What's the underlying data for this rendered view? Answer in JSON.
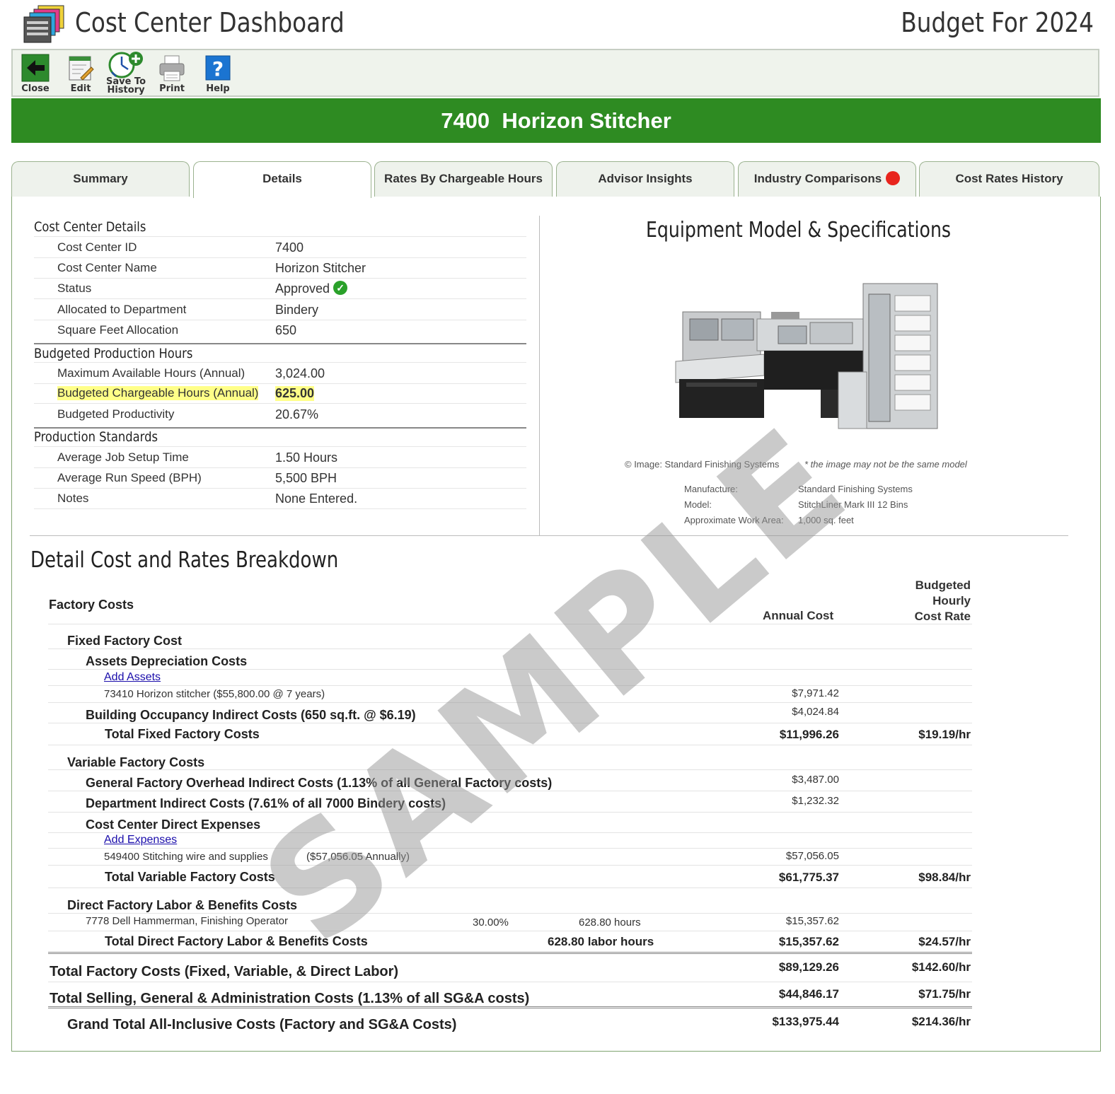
{
  "header": {
    "title": "Cost Center Dashboard",
    "budget_title": "Budget For 2024"
  },
  "toolbar": {
    "close": "Close",
    "edit": "Edit",
    "save_line1": "Save To",
    "save_line2": "History",
    "print": "Print",
    "help": "Help"
  },
  "banner": "7400  Horizon Stitcher",
  "tabs": [
    {
      "label": "Summary"
    },
    {
      "label": "Details"
    },
    {
      "label": "Rates By Chargeable Hours"
    },
    {
      "label": "Advisor Insights"
    },
    {
      "label": "Industry Comparisons"
    },
    {
      "label": "Cost Rates History"
    }
  ],
  "details": {
    "section1": "Cost Center Details",
    "rows1": [
      {
        "label": "Cost Center ID",
        "value": "7400"
      },
      {
        "label": "Cost Center Name",
        "value": "Horizon Stitcher"
      },
      {
        "label": "Status",
        "value": "Approved"
      },
      {
        "label": "Allocated to Department",
        "value": "Bindery"
      },
      {
        "label": "Square Feet Allocation",
        "value": "650"
      }
    ],
    "section2": "Budgeted Production Hours",
    "rows2": [
      {
        "label": "Maximum Available Hours (Annual)",
        "value": "3,024.00"
      },
      {
        "label": "Budgeted Chargeable Hours (Annual)",
        "value": "625.00"
      },
      {
        "label": "Budgeted Productivity",
        "value": "20.67%"
      }
    ],
    "section3": "Production Standards",
    "rows3": [
      {
        "label": "Average Job Setup Time",
        "value": "1.50 Hours"
      },
      {
        "label": "Average Run Speed  (BPH)",
        "value": "5,500 BPH"
      },
      {
        "label": "Notes",
        "value": "None Entered."
      }
    ]
  },
  "equipment": {
    "title": "Equipment Model & Specifications",
    "credit": "© Image: Standard Finishing Systems",
    "credit_note": "* the image may not be the same model",
    "specs": [
      {
        "key": "Manufacture:",
        "value": "Standard Finishing Systems"
      },
      {
        "key": "Model:",
        "value": "StitchLiner Mark III 12 Bins"
      },
      {
        "key": "Approximate Work Area:",
        "value": "1,000 sq. feet"
      }
    ]
  },
  "breakdown": {
    "title": "Detail Cost and Rates Breakdown",
    "factory_costs": "Factory Costs",
    "col_annual": "Annual Cost",
    "col_rate": "Budgeted\nHourly\nCost Rate",
    "fixed_factory_cost": "Fixed Factory Cost",
    "assets_depreciation": "Assets Depreciation Costs",
    "add_assets": "Add Assets",
    "asset_line": "73410 Horizon stitcher  ($55,800.00 @ 7 years)",
    "asset_amount": "$7,971.42",
    "building_occupancy": "Building Occupancy Indirect Costs (650 sq.ft. @ $6.19)",
    "building_amount": "$4,024.84",
    "total_fixed": "Total Fixed Factory Costs",
    "total_fixed_amount": "$11,996.26",
    "total_fixed_rate": "$19.19/hr",
    "variable_factory": "Variable Factory Costs",
    "general_overhead": "General Factory Overhead Indirect Costs (1.13% of all General Factory costs)",
    "general_overhead_amount": "$3,487.00",
    "department_indirect": "Department Indirect Costs (7.61% of all 7000 Bindery costs)",
    "department_indirect_amount": "$1,232.32",
    "direct_expenses": "Cost Center Direct Expenses",
    "add_expenses": "Add Expenses",
    "expense_line": "549400 Stitching wire and supplies",
    "expense_annual": "($57,056.05 Annually)",
    "expense_amount": "$57,056.05",
    "total_variable": "Total Variable Factory Costs",
    "total_variable_amount": "$61,775.37",
    "total_variable_rate": "$98.84/hr",
    "direct_labor": "Direct Factory Labor & Benefits Costs",
    "labor_line": "7778 Dell Hammerman, Finishing Operator",
    "labor_pct": "30.00%",
    "labor_hours": "628.80 hours",
    "labor_amount": "$15,357.62",
    "total_labor": "Total Direct Factory Labor & Benefits Costs",
    "total_labor_hours": "628.80 labor hours",
    "total_labor_amount": "$15,357.62",
    "total_labor_rate": "$24.57/hr",
    "total_factory": "Total Factory Costs (Fixed, Variable, & Direct Labor)",
    "total_factory_amount": "$89,129.26",
    "total_factory_rate": "$142.60/hr",
    "total_sga": "Total Selling, General & Administration Costs (1.13% of all SG&A costs)",
    "total_sga_amount": "$44,846.17",
    "total_sga_rate": "$71.75/hr",
    "grand_total": "Grand Total All-Inclusive Costs (Factory and SG&A Costs)",
    "grand_total_amount": "$133,975.44",
    "grand_total_rate": "$214.36/hr"
  },
  "watermark": "SAMPLE",
  "colors": {
    "banner": "#2e8b22",
    "tab_bg": "#eef2ec",
    "highlight": "#ffff88",
    "alert_dot": "#e8251d"
  }
}
